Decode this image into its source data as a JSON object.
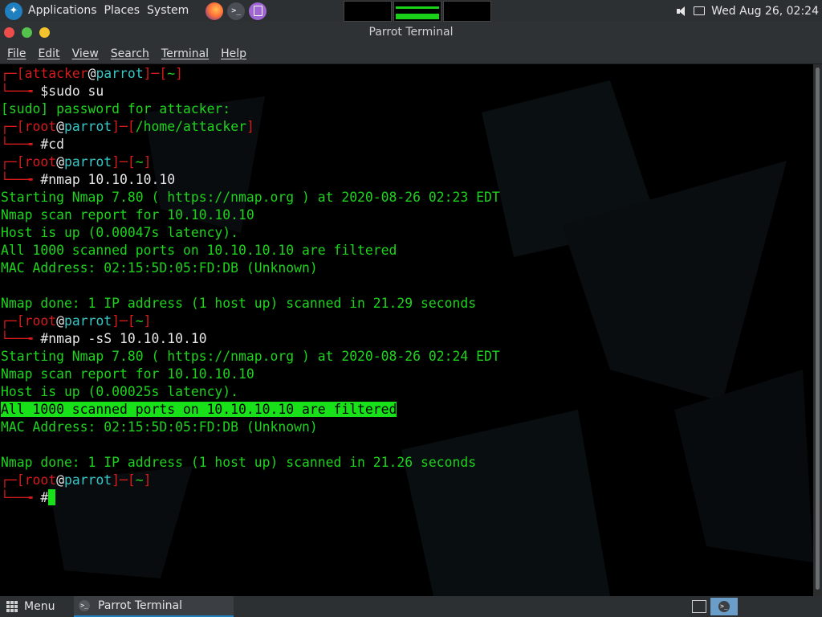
{
  "top_panel": {
    "menus": [
      "Applications",
      "Places",
      "System"
    ],
    "clock": "Wed Aug 26, 02:24"
  },
  "window": {
    "title": "Parrot Terminal",
    "menu": [
      "File",
      "Edit",
      "View",
      "Search",
      "Terminal",
      "Help"
    ]
  },
  "terminal": {
    "lines": [
      {
        "type": "prompt",
        "user": "attacker",
        "host": "parrot",
        "dir": "~"
      },
      {
        "type": "cmd",
        "sym": "$",
        "text": "sudo su"
      },
      {
        "type": "out",
        "text": "[sudo] password for attacker:"
      },
      {
        "type": "prompt",
        "user": "root",
        "host": "parrot",
        "dir": "/home/attacker"
      },
      {
        "type": "cmd",
        "sym": "#",
        "text": "cd"
      },
      {
        "type": "prompt",
        "user": "root",
        "host": "parrot",
        "dir": "~"
      },
      {
        "type": "cmd",
        "sym": "#",
        "text": "nmap 10.10.10.10"
      },
      {
        "type": "out",
        "text": "Starting Nmap 7.80 ( https://nmap.org ) at 2020-08-26 02:23 EDT"
      },
      {
        "type": "out",
        "text": "Nmap scan report for 10.10.10.10"
      },
      {
        "type": "out",
        "text": "Host is up (0.00047s latency)."
      },
      {
        "type": "out",
        "text": "All 1000 scanned ports on 10.10.10.10 are filtered"
      },
      {
        "type": "out",
        "text": "MAC Address: 02:15:5D:05:FD:DB (Unknown)"
      },
      {
        "type": "out",
        "text": ""
      },
      {
        "type": "out",
        "text": "Nmap done: 1 IP address (1 host up) scanned in 21.29 seconds"
      },
      {
        "type": "prompt",
        "user": "root",
        "host": "parrot",
        "dir": "~"
      },
      {
        "type": "cmd",
        "sym": "#",
        "text": "nmap -sS 10.10.10.10"
      },
      {
        "type": "out",
        "text": "Starting Nmap 7.80 ( https://nmap.org ) at 2020-08-26 02:24 EDT"
      },
      {
        "type": "out",
        "text": "Nmap scan report for 10.10.10.10"
      },
      {
        "type": "out",
        "text": "Host is up (0.00025s latency)."
      },
      {
        "type": "out",
        "text": "All 1000 scanned ports on 10.10.10.10 are filtered",
        "highlight": true
      },
      {
        "type": "out",
        "text": "MAC Address: 02:15:5D:05:FD:DB (Unknown)"
      },
      {
        "type": "out",
        "text": ""
      },
      {
        "type": "out",
        "text": "Nmap done: 1 IP address (1 host up) scanned in 21.26 seconds"
      },
      {
        "type": "prompt",
        "user": "root",
        "host": "parrot",
        "dir": "~"
      },
      {
        "type": "cmd",
        "sym": "#",
        "text": "",
        "cursor": true
      }
    ]
  },
  "bottom_panel": {
    "menu_label": "Menu",
    "task_label": "Parrot Terminal"
  },
  "colors": {
    "prompt_bracket": "#d51b1b",
    "host": "#38c6c6",
    "output": "#1dd31d",
    "highlight": "#19e119"
  }
}
